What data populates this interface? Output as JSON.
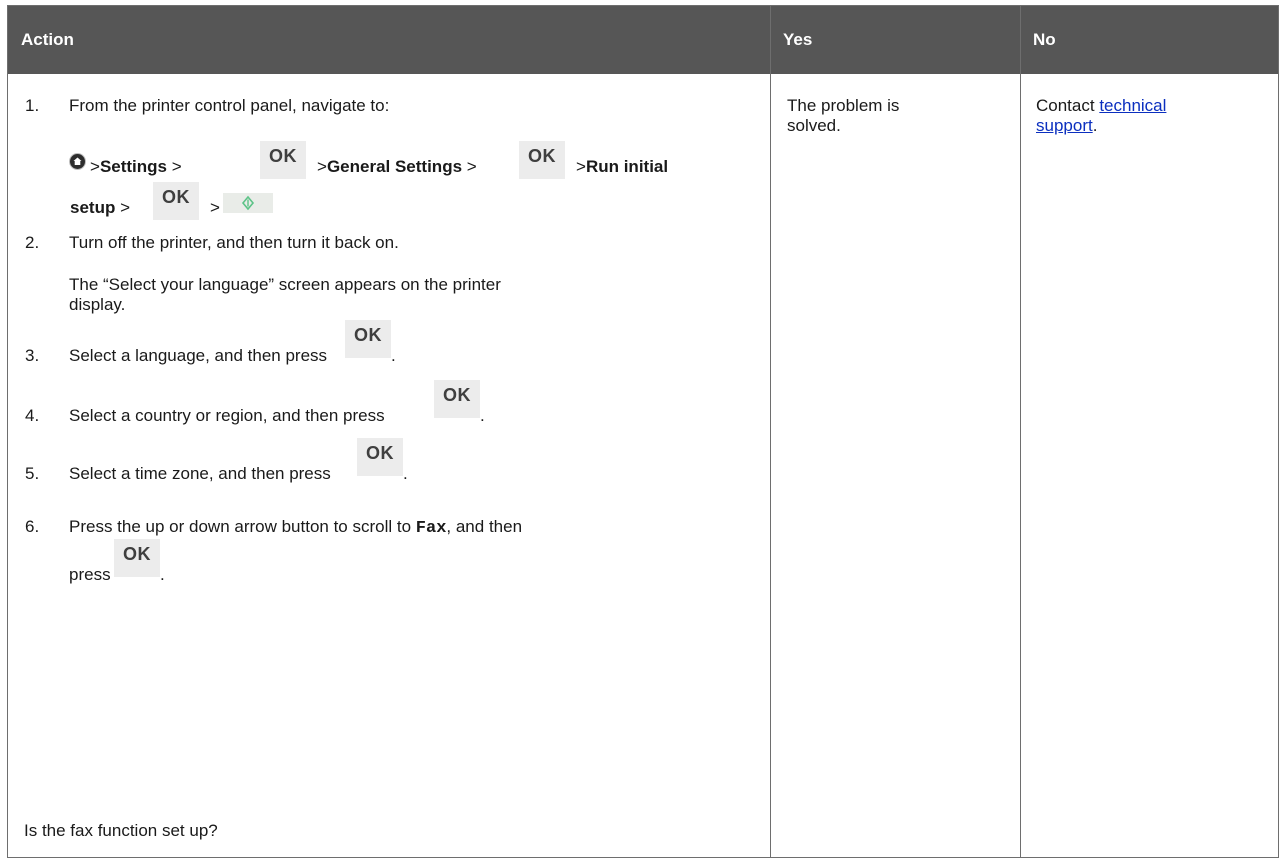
{
  "header": {
    "action": "Action",
    "yes": "Yes",
    "no": "No"
  },
  "steps": {
    "s1": {
      "num": "1.",
      "text": "From the printer control panel, navigate to:",
      "path": {
        "sep1": ">",
        "settings": "Settings",
        "sep2": ">",
        "sep3": ">",
        "general": "General Settings",
        "sep4": ">",
        "sep5": ">",
        "run1": "Run initial",
        "run2": "setup",
        "sep6": ">",
        "sep7": ">"
      }
    },
    "s2": {
      "num": "2.",
      "text": "Turn off the printer, and then turn it back on.",
      "note1": "The “Select your language” screen appears on the printer",
      "note2": "display."
    },
    "s3": {
      "num": "3.",
      "text": "Select a language, and then press",
      "end": "."
    },
    "s4": {
      "num": "4.",
      "text": "Select a country or region, and then press",
      "end": "."
    },
    "s5": {
      "num": "5.",
      "text": "Select a time zone, and then press",
      "end": "."
    },
    "s6": {
      "num": "6.",
      "text_a": "Press the up or down arrow button to scroll to ",
      "code": "Fax",
      "text_b": ", and then",
      "text_c": "press",
      "end": "."
    }
  },
  "ok_label": "OK",
  "question": "Is the fax function set up?",
  "yes_cell": {
    "line1": "The problem is",
    "line2": "solved."
  },
  "no_cell": {
    "pre": "Contact ",
    "link1": "technical",
    "link2": "support",
    "end": "."
  },
  "icons": {
    "home": "home-icon",
    "start": "start-icon",
    "ok": "ok-button-icon"
  },
  "colors": {
    "header_bg": "#565656",
    "link": "#0b2fbf",
    "start_diamond": "#5cc387"
  }
}
